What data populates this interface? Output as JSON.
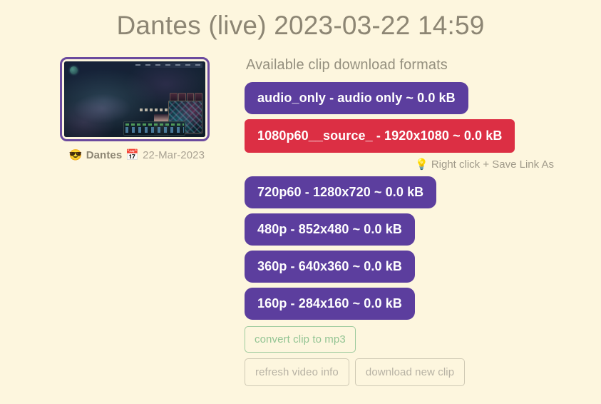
{
  "page": {
    "title": "Dantes (live) 2023-03-22 14:59"
  },
  "clip": {
    "thumbnail_alt": "League of Legends gameplay thumbnail",
    "uploader_icon": "😎",
    "uploader": "Dantes",
    "date_icon": "📅",
    "date": "22-Mar-2023"
  },
  "formats": {
    "heading": "Available clip download formats",
    "hint_icon": "💡",
    "hint": "Right click + Save Link As",
    "items": [
      {
        "label": "audio_only - audio only ~ 0.0 kB",
        "style": "purple"
      },
      {
        "label": "1080p60__source_ - 1920x1080 ~ 0.0 kB",
        "style": "red"
      },
      {
        "label": "720p60 - 1280x720 ~ 0.0 kB",
        "style": "purple"
      },
      {
        "label": "480p - 852x480 ~ 0.0 kB",
        "style": "purple"
      },
      {
        "label": "360p - 640x360 ~ 0.0 kB",
        "style": "purple"
      },
      {
        "label": "160p - 284x160 ~ 0.0 kB",
        "style": "purple"
      }
    ]
  },
  "actions": {
    "convert_mp3": "convert clip to mp3",
    "refresh_info": "refresh video info",
    "download_new": "download new clip"
  },
  "colors": {
    "background": "#fdf6de",
    "purple": "#5c3e9e",
    "red": "#dc2f44",
    "green_outline": "#9ecb9e",
    "gray_outline": "#cfc9b4",
    "title_text": "#8d8674"
  }
}
